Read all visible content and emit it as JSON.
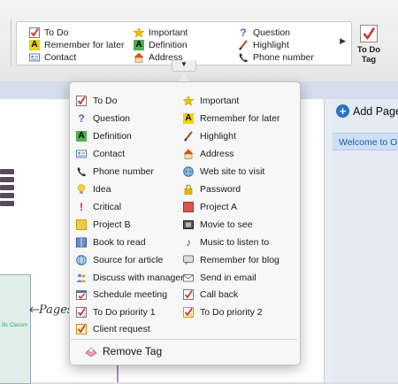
{
  "colors": {
    "accent_blue": "#2a72c6",
    "check_red": "#d22",
    "tag_yellow": "#f2d200",
    "purple": "#7a4fb0"
  },
  "ribbon": {
    "gallery_items": [
      {
        "label": "To Do",
        "icon": "checkbox-icon"
      },
      {
        "label": "Important",
        "icon": "star-icon"
      },
      {
        "label": "Question",
        "icon": "question-icon"
      },
      {
        "label": "Remember for later",
        "icon": "highlight-a-icon"
      },
      {
        "label": "Definition",
        "icon": "definition-a-icon"
      },
      {
        "label": "Highlight",
        "icon": "marker-icon"
      },
      {
        "label": "Contact",
        "icon": "contact-card-icon"
      },
      {
        "label": "Address",
        "icon": "house-icon"
      },
      {
        "label": "Phone number",
        "icon": "phone-icon"
      }
    ],
    "todo_tag_button": "To Do\nTag"
  },
  "right_panel": {
    "add_page": "Add Page",
    "page_item": "Welcome to On"
  },
  "canvas": {
    "pages_label": "Pages",
    "thumb_text": "ific Classm"
  },
  "menu": {
    "items": [
      {
        "label": "To Do",
        "icon": "checkbox-icon"
      },
      {
        "label": "Important",
        "icon": "star-icon"
      },
      {
        "label": "Question",
        "icon": "question-icon"
      },
      {
        "label": "Remember for later",
        "icon": "highlight-a-icon"
      },
      {
        "label": "Definition",
        "icon": "definition-a-icon"
      },
      {
        "label": "Highlight",
        "icon": "marker-icon"
      },
      {
        "label": "Contact",
        "icon": "contact-card-icon"
      },
      {
        "label": "Address",
        "icon": "house-icon"
      },
      {
        "label": "Phone number",
        "icon": "phone-icon"
      },
      {
        "label": "Web site to visit",
        "icon": "globe-icon"
      },
      {
        "label": "Idea",
        "icon": "lightbulb-icon"
      },
      {
        "label": "Password",
        "icon": "padlock-icon"
      },
      {
        "label": "Critical",
        "icon": "exclamation-icon"
      },
      {
        "label": "Project A",
        "icon": "red-square-icon"
      },
      {
        "label": "Project B",
        "icon": "yellow-square-icon"
      },
      {
        "label": "Movie to see",
        "icon": "film-icon"
      },
      {
        "label": "Book to read",
        "icon": "book-icon"
      },
      {
        "label": "Music to listen to",
        "icon": "music-note-icon"
      },
      {
        "label": "Source for article",
        "icon": "source-globe-icon"
      },
      {
        "label": "Remember for blog",
        "icon": "speech-bubble-icon"
      },
      {
        "label": "Discuss with manager",
        "icon": "people-icon"
      },
      {
        "label": "Send in email",
        "icon": "email-icon"
      },
      {
        "label": "Schedule meeting",
        "icon": "calendar-check-icon"
      },
      {
        "label": "Call back",
        "icon": "phone-check-icon"
      },
      {
        "label": "To Do priority 1",
        "icon": "todo-priority-1-icon"
      },
      {
        "label": "To Do priority 2",
        "icon": "todo-priority-2-icon"
      },
      {
        "label": "Client request",
        "icon": "client-check-icon"
      }
    ],
    "remove_tag": "Remove Tag"
  }
}
